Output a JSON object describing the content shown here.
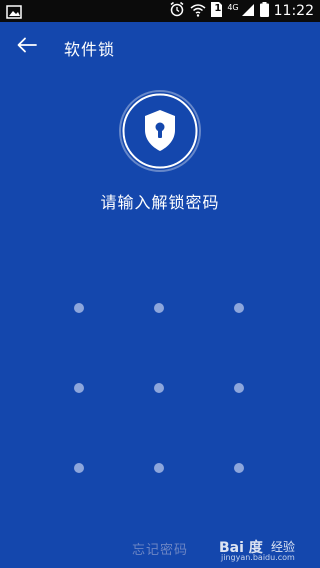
{
  "status_bar": {
    "network_label": "4G",
    "sim_label": "1",
    "time": "11:22",
    "icons": [
      "image-icon",
      "alarm-icon",
      "wifi-icon",
      "sim-icon",
      "signal-icon",
      "battery-icon"
    ]
  },
  "header": {
    "title": "软件锁",
    "back_icon": "back-arrow-icon"
  },
  "lock": {
    "icon": "shield-keyhole-icon",
    "prompt": "请输入解锁密码"
  },
  "pattern": {
    "rows": 3,
    "cols": 3
  },
  "footer": {
    "forgot_label": "忘记密码"
  },
  "watermark": {
    "logo": "Bai 度",
    "text": "经验",
    "url": "jingyan.baidu.com"
  },
  "colors": {
    "background": "#1447ad",
    "status_bar": "#0b0b0b",
    "dot": "#8da6dc",
    "forgot_text": "#6d86c4"
  }
}
